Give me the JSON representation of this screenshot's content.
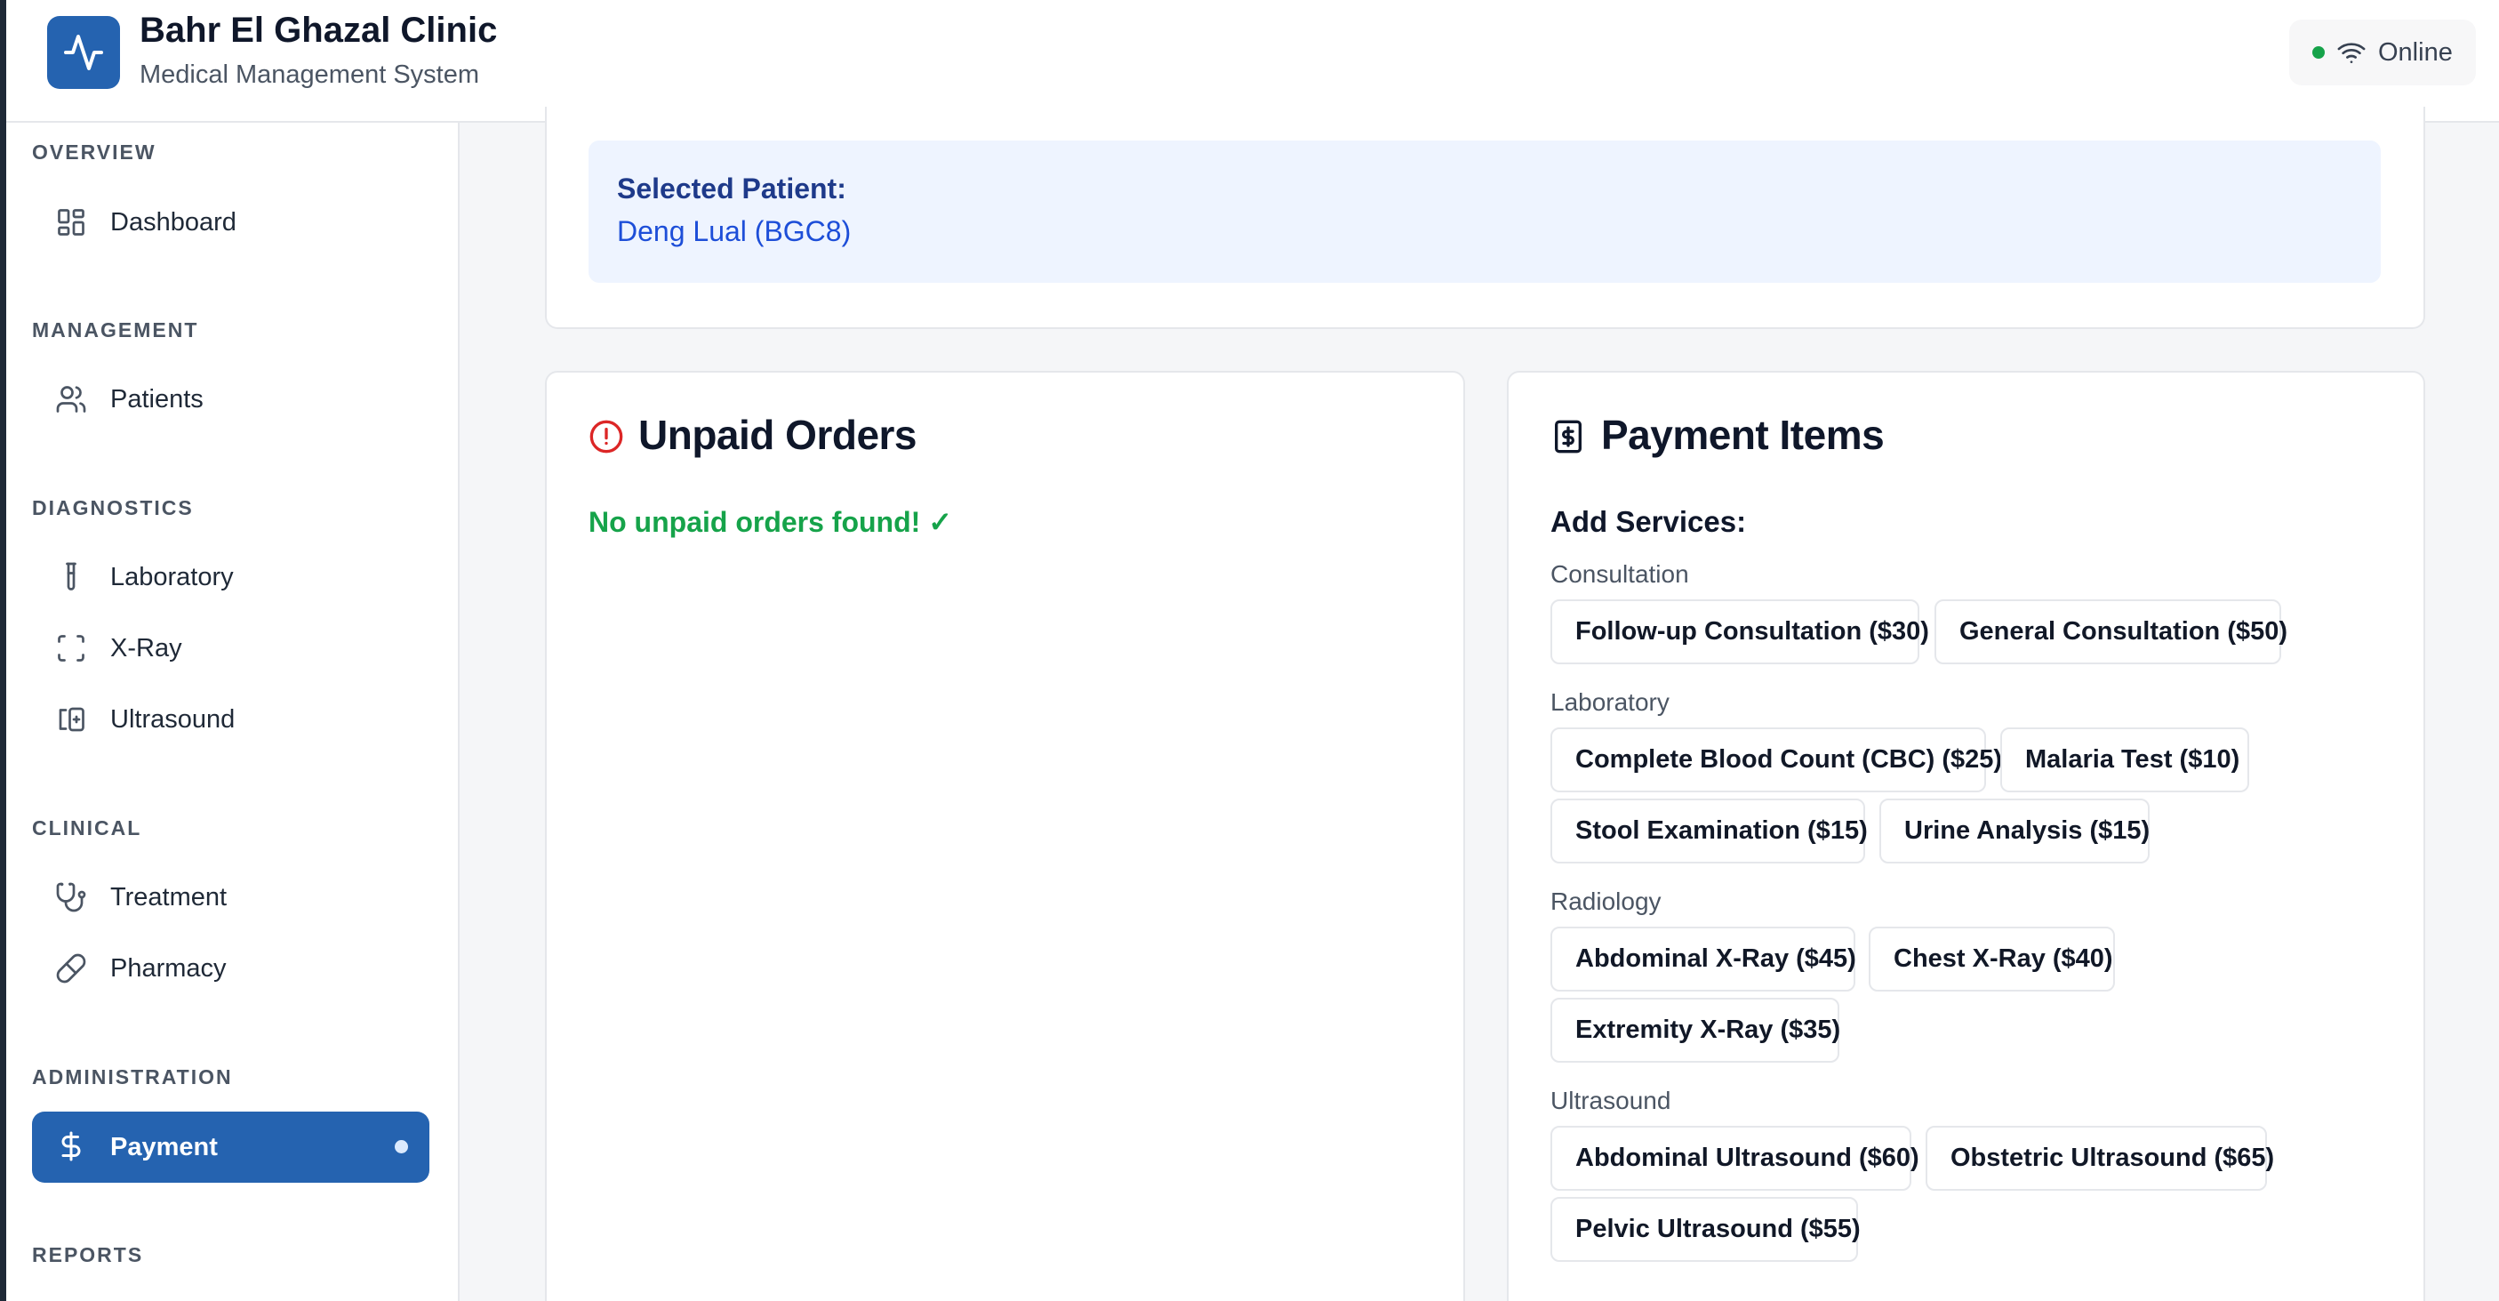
{
  "header": {
    "title": "Bahr El Ghazal Clinic",
    "subtitle": "Medical Management System",
    "status": "Online",
    "logo_icon": "activity-icon"
  },
  "sidebar": {
    "sections": {
      "overview": "OVERVIEW",
      "management": "MANAGEMENT",
      "diagnostics": "DIAGNOSTICS",
      "clinical": "CLINICAL",
      "administration": "ADMINISTRATION",
      "reports": "REPORTS"
    },
    "items": [
      {
        "label": "Dashboard",
        "icon": "dashboard-icon"
      },
      {
        "label": "Patients",
        "icon": "users-icon"
      },
      {
        "label": "Laboratory",
        "icon": "test-tube-icon"
      },
      {
        "label": "X-Ray",
        "icon": "scan-icon"
      },
      {
        "label": "Ultrasound",
        "icon": "ultrasound-icon"
      },
      {
        "label": "Treatment",
        "icon": "stethoscope-icon"
      },
      {
        "label": "Pharmacy",
        "icon": "pill-icon"
      },
      {
        "label": "Payment",
        "icon": "dollar-icon",
        "active": true
      }
    ]
  },
  "patient": {
    "label": "Selected Patient:",
    "name": "Deng Lual (BGC8)"
  },
  "unpaid": {
    "title": "Unpaid Orders",
    "empty_message": "No unpaid orders found! ✓"
  },
  "payment": {
    "title": "Payment Items",
    "add_label": "Add Services:",
    "groups": [
      {
        "name": "Consultation",
        "services": [
          "Follow-up Consultation ($30)",
          "General Consultation ($50)"
        ]
      },
      {
        "name": "Laboratory",
        "services": [
          "Complete Blood Count (CBC) ($25)",
          "Malaria Test ($10)",
          "Stool Examination ($15)",
          "Urine Analysis ($15)"
        ]
      },
      {
        "name": "Radiology",
        "services": [
          "Abdominal X-Ray ($45)",
          "Chest X-Ray ($40)",
          "Extremity X-Ray ($35)"
        ]
      },
      {
        "name": "Ultrasound",
        "services": [
          "Abdominal Ultrasound ($60)",
          "Obstetric Ultrasound ($65)",
          "Pelvic Ultrasound ($55)"
        ]
      }
    ]
  },
  "colors": {
    "brand": "#2563b0",
    "success": "#16a34a",
    "alert": "#dc2626",
    "patient_bg": "#eef4ff"
  }
}
